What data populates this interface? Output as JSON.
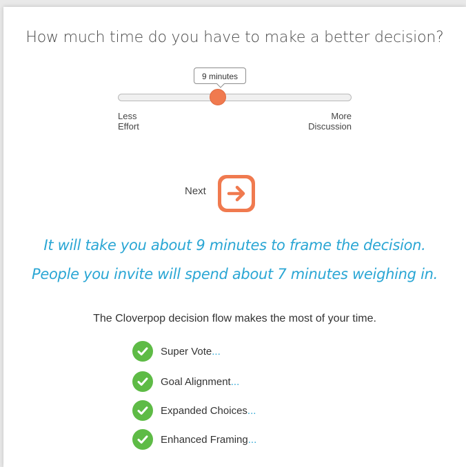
{
  "question": "How much time do you have to make a better decision?",
  "slider": {
    "value_label": "9 minutes",
    "value_minutes": 9,
    "position": 0.43,
    "left_label": [
      "Less",
      "Effort"
    ],
    "right_label": [
      "More",
      "Discussion"
    ]
  },
  "next": {
    "label": "Next",
    "icon": "arrow-right-icon"
  },
  "messages": {
    "frame": "It will take you about 9 minutes to frame the decision.",
    "invite": "People you invite will spend about 7 minutes weighing in."
  },
  "flow_text": "The Cloverpop decision flow makes the most of your time.",
  "features": [
    {
      "label": "Super Vote",
      "more": "..."
    },
    {
      "label": "Goal Alignment",
      "more": "..."
    },
    {
      "label": "Expanded Choices",
      "more": "..."
    },
    {
      "label": "Enhanced Framing",
      "more": "..."
    }
  ],
  "colors": {
    "accent_orange": "#f07a4f",
    "accent_blue": "#2aa6d4",
    "check_green": "#5ebb46"
  }
}
